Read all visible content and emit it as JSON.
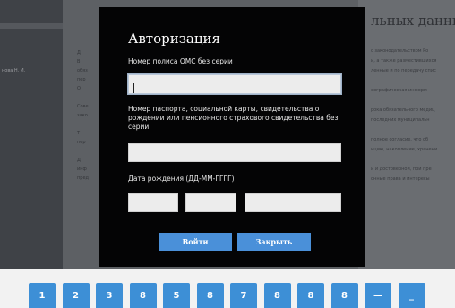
{
  "background": {
    "left_name": "нова Н. И.",
    "right_heading": "льных данных",
    "right_lines": [
      "с законодательством Ро",
      "и, а также разместившихся",
      "ленные и по передачу спис",
      "",
      "еографическая информ",
      "",
      "рока обязательного медиц",
      "последних муниципальн",
      "",
      "полное согласие, что об",
      "ицию, накопление, хранени",
      "",
      "й и достоверной, при пре",
      "онные права и интересы"
    ],
    "center_frags": [
      "Д",
      "В",
      "обяз",
      "пер",
      "О",
      "",
      "Сове",
      "зако",
      "",
      "Т",
      "пер",
      "",
      "Д",
      "инф",
      "пред"
    ]
  },
  "modal": {
    "title": "Авторизация",
    "oms_label": "Номер полиса ОМС без серии",
    "oms_value": "",
    "doc_label": "Номер паспорта, социальной карты, свидетельства о рождении или пенсионного страхового свидетельства без серии",
    "doc_value": "",
    "dob_label": "Дата рождения (ДД-ММ-ГГГГ)",
    "dob_day": "",
    "dob_month": "",
    "dob_year": "",
    "login_label": "Войти",
    "close_label": "Закрыть"
  },
  "keyboard": {
    "keys": [
      "1",
      "2",
      "3",
      "8",
      "5",
      "8",
      "7",
      "8",
      "8",
      "8",
      "—",
      "_"
    ]
  }
}
